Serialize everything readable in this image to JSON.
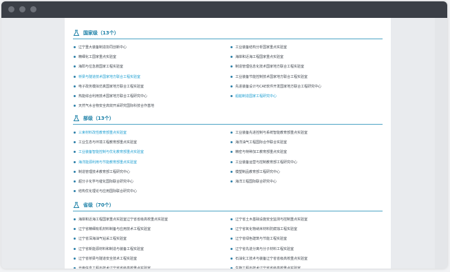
{
  "sections": [
    {
      "title": "国家级（13个）",
      "items": [
        {
          "text": "辽宁重大装备制造协同创新中心",
          "hl": false
        },
        {
          "text": "工业装备结构分析国家重点实验室",
          "hl": false
        },
        {
          "text": "精细化工国家重点实验室",
          "hl": false
        },
        {
          "text": "海岸和近海工程国家重点实验室",
          "hl": false
        },
        {
          "text": "海阳与位急救国家工程实验室",
          "hl": false
        },
        {
          "text": "制造管理信息化技术国家地方联合工程实验室",
          "hl": false
        },
        {
          "text": "桥梁与隧道技术国家地方联合工程实验室",
          "hl": true
        },
        {
          "text": "工业装备节能控制技术国家地方联合工程实验室",
          "hl": false
        },
        {
          "text": "电子政务模拟仿真国家地方联合工程实验室",
          "hl": false
        },
        {
          "text": "先进装备设计与CAE软件开发国家地方联合工程研究中心",
          "hl": false
        },
        {
          "text": "热能综合利用技术国家地方联合工程研究中心",
          "hl": false
        },
        {
          "text": "船舶制造国家工程研究中心",
          "hl": true
        },
        {
          "text": "天然气水合物安全高效开采研究国际科技合作基地",
          "hl": false
        }
      ]
    },
    {
      "title": "部级（13个）",
      "items": [
        {
          "text": "三束材料改性教育部重点实验室",
          "hl": true
        },
        {
          "text": "工业装备先进控制与系统智能教育部重点实验室",
          "hl": false
        },
        {
          "text": "工业生态与环境工程教育部重点实验室",
          "hl": false
        },
        {
          "text": "海洋油气工程国际合作联合实验室",
          "hl": false
        },
        {
          "text": "工业装备智能控制与优化教育部重点实验室",
          "hl": true
        },
        {
          "text": "精密与特种加工教育部重点实验室",
          "hl": false
        },
        {
          "text": "海洋能源利用与节能教育部重点实验室",
          "hl": true
        },
        {
          "text": "工业装备运营与控制教育部工程研究中心",
          "hl": false
        },
        {
          "text": "制造管理技术教育部工程研究中心",
          "hl": false
        },
        {
          "text": "模塑制品教育部工程研究中心",
          "hl": false
        },
        {
          "text": "超分子化学与催化国际联合研究中心",
          "hl": false
        },
        {
          "text": "海洋工程国际联合研究中心",
          "hl": false
        },
        {
          "text": "结构优化理论与应用国际联合研究中心",
          "hl": false
        }
      ]
    },
    {
      "title": "省级（70个）",
      "items": [
        {
          "text": "海岸和近海工程国家重点实验室辽宁省省级高校重点实验室",
          "hl": false
        },
        {
          "text": "辽宁省土木基础设施安全监测与控制重点实验室",
          "hl": false
        },
        {
          "text": "辽宁省精细有机材料制备与应用技术工程实验室",
          "hl": false
        },
        {
          "text": "辽宁省氧化物纳米材料防腐蚀工程实验室",
          "hl": false
        },
        {
          "text": "辽宁省深海油气钻采工程实验室",
          "hl": false
        },
        {
          "text": "辽宁省绿色建筑与节能工程实验室",
          "hl": false
        },
        {
          "text": "辽宁省新能源材料和制造与装备工程实验室",
          "hl": false
        },
        {
          "text": "辽宁省先进分离与分子材料工程实验室",
          "hl": false
        },
        {
          "text": "辽宁省桥梁与隧道安全技术工程实验室",
          "hl": false
        },
        {
          "text": "石油化工技术与装备辽宁省省级高校重点实验室",
          "hl": false
        },
        {
          "text": "光电信息工程与技术辽宁省省级高校重点实验室",
          "hl": false
        },
        {
          "text": "生物工程与技术辽宁省省级高校重点实验室",
          "hl": false
        }
      ]
    }
  ],
  "colors": {
    "accent": "#1a7fa6",
    "link_highlight": "#1e9fd2",
    "titlebar": "#3b3f47"
  }
}
